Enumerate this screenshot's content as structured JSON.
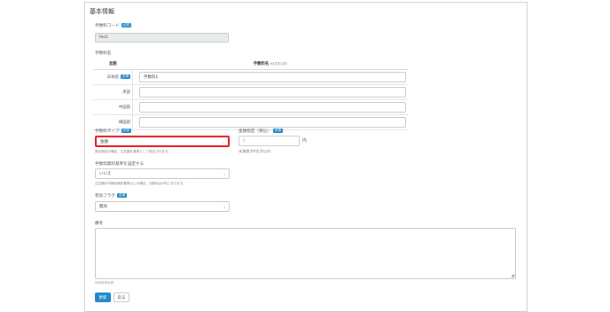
{
  "panel_title": "基本情報",
  "required_badge": "必須",
  "code": {
    "label": "手数料コード",
    "value": "fee1"
  },
  "name": {
    "label": "手数料名",
    "col_lang": "言語",
    "col_name": "手数料名",
    "col_name_note": "64文字以内",
    "rows": [
      {
        "lang": "日本語",
        "required": true,
        "value": "手数料1"
      },
      {
        "lang": "英語",
        "required": false,
        "value": ""
      },
      {
        "lang": "中国語",
        "required": false,
        "value": ""
      },
      {
        "lang": "韓国語",
        "required": false,
        "value": ""
      }
    ]
  },
  "fee_type": {
    "label": "手数料タイプ",
    "value": "金額",
    "hint": "割引指定の場合、注文額を基準として算出されます。"
  },
  "amount": {
    "label": "金額指定（税込）",
    "placeholder": "0",
    "unit": "円",
    "hint": "半角数字9文字以内"
  },
  "free_condition": {
    "label": "手数料無料基準を設定する",
    "value": "いいえ",
    "hint": "注文額が手数料無料基準以上の場合、手数料は0円になります。"
  },
  "valid_flag": {
    "label": "有効フラグ",
    "value": "無効"
  },
  "remarks": {
    "label": "備考",
    "hint": "256文字以内"
  },
  "buttons": {
    "update": "更新",
    "back": "戻る"
  },
  "colors": {
    "accent": "#1e88c8",
    "highlight": "#e0161b"
  }
}
